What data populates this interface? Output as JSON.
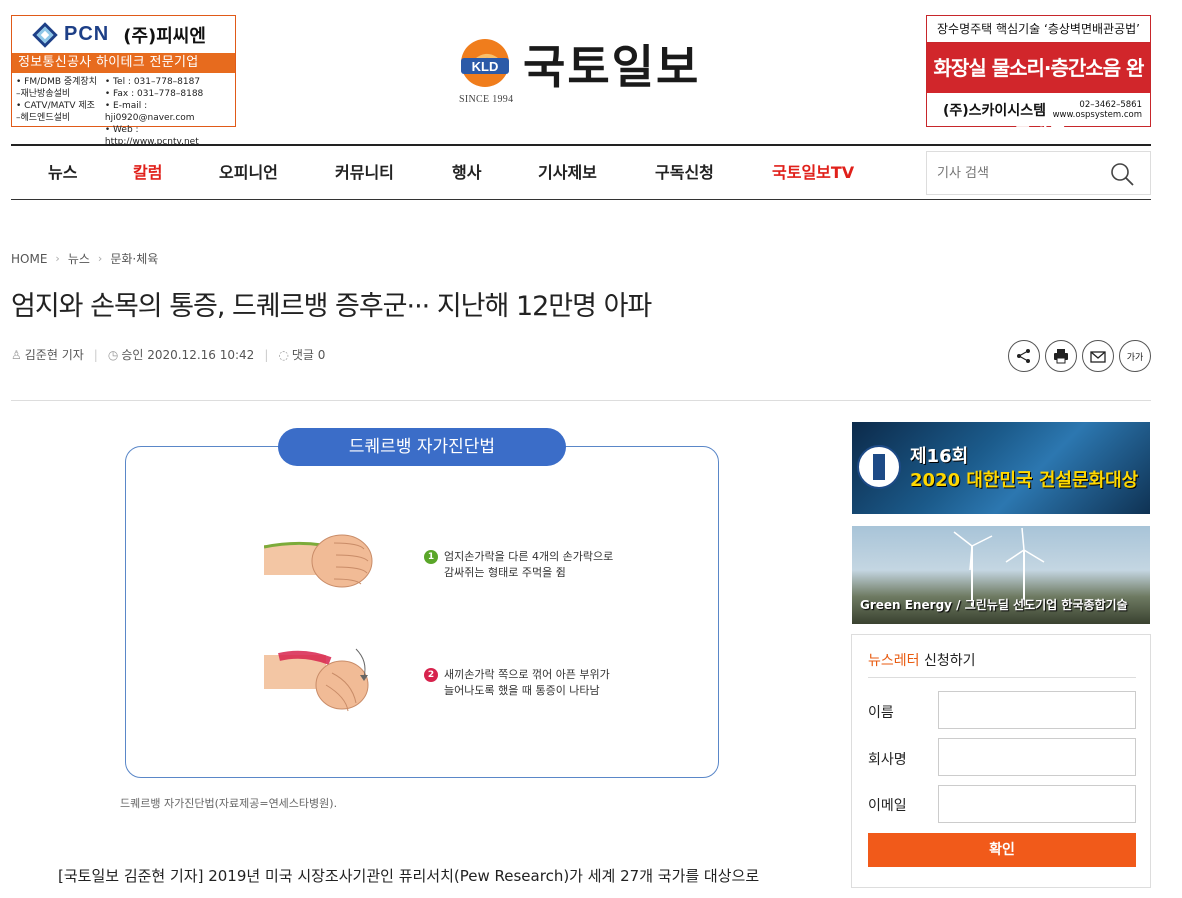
{
  "header": {
    "left_ad": {
      "brand": "PCN",
      "company": "(주)피씨엔",
      "band": "정보통신공사 하이테크 전문기업",
      "left_lines": [
        "• FM/DMB 중계장치",
        " –재난방송설비",
        "• CATV/MATV 제조",
        " –헤드엔드설비"
      ],
      "right_lines": [
        "• Tel : 031–778–8187",
        "• Fax : 031–778–8188",
        "• E-mail : hji0920@naver.com",
        "• Web : http://www.pcntv.net"
      ]
    },
    "logo": {
      "mark": "KLD",
      "since": "SINCE 1994",
      "name": "국토일보"
    },
    "right_ad": {
      "top": "장수명주택 핵심기술 ‘층상벽면배관공법’",
      "headline": "화장실 물소리·층간소음 완전해결",
      "company": "(주)스카이시스템",
      "phone": "02–3462–5861",
      "web": "www.ospsystem.com"
    }
  },
  "nav": {
    "items": [
      {
        "label": "뉴스"
      },
      {
        "label": "칼럼"
      },
      {
        "label": "오피니언"
      },
      {
        "label": "커뮤니티"
      },
      {
        "label": "행사"
      },
      {
        "label": "기사제보"
      },
      {
        "label": "구독신청"
      },
      {
        "label": "국토일보TV"
      }
    ],
    "search_placeholder": "기사 검색"
  },
  "article": {
    "breadcrumb": [
      "HOME",
      "뉴스",
      "문화·체육"
    ],
    "title": "엄지와 손목의 통증, 드퀘르뱅 증후군··· 지난해 12만명 아파",
    "author": "김준현 기자",
    "approved": "승인 2020.12.16 10:42",
    "comments": "댓글 0",
    "font_button": "가가",
    "figure": {
      "title": "드퀘르뱅 자가진단법",
      "step1_num": "1",
      "step1_text": [
        "엄지손가락을 다른 4개의 손가락으로",
        "감싸쥐는 형태로 주먹을 쥠"
      ],
      "step2_num": "2",
      "step2_text": [
        "새끼손가락 쪽으로 꺾어 아픈 부위가",
        "늘어나도록 했을 때 통증이 나타남"
      ]
    },
    "caption": "드퀘르뱅 자가진단법(자료제공=연세스타병원).",
    "body": "[국토일보 김준현 기자] 2019년 미국 시장조사기관인 퓨리서치(Pew Research)가 세계 27개 국가를 대상으로"
  },
  "sidebar": {
    "banner1": {
      "line1": "제16회",
      "line2_a": "2020 대한민국 ",
      "line2_b": "건설문화대상"
    },
    "banner2": {
      "text": "Green Energy / 그린뉴딜 선도기업 한국종합기술"
    },
    "newsletter": {
      "title_accent": "뉴스레터",
      "title_rest": " 신청하기",
      "fields": [
        "이름",
        "회사명",
        "이메일"
      ],
      "submit": "확인"
    }
  },
  "colors": {
    "accent_red": "#e0201a",
    "newsletter_orange": "#f15a1a",
    "figure_blue": "#3b6dc8"
  }
}
